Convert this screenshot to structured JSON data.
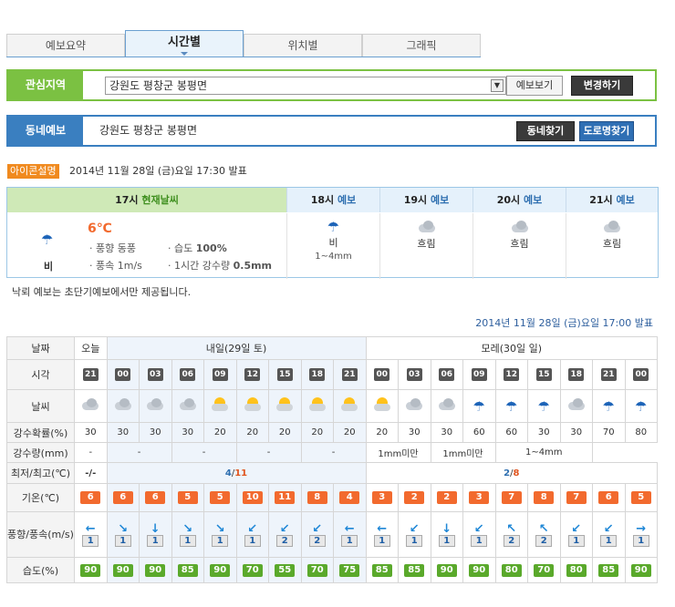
{
  "tabs": [
    "예보요약",
    "시간별",
    "위치별",
    "그래픽"
  ],
  "panel1": {
    "label": "관심지역",
    "select": "강원도 평창군 봉평면",
    "btn1": "예보보기",
    "btn2": "변경하기"
  },
  "panel2": {
    "label": "동네예보",
    "location": "강원도 평창군 봉평면",
    "btn1": "동네찾기",
    "btn2": "도로명찾기"
  },
  "icon_legend": "아이콘설명",
  "issue_time_1": "2014년 11월 28일 (금)요일 17:30 발표",
  "now": {
    "head_hour": "17시",
    "head_tag": "현재날씨",
    "weather": "비",
    "temp": "6℃",
    "wind_dir_label": "풍향",
    "wind_dir": "동풍",
    "humidity_label": "습도",
    "humidity": "100%",
    "wind_speed_label": "풍속",
    "wind_speed": "1m/s",
    "rain_label": "1시간 강수량",
    "rain": "0.5mm"
  },
  "short_forecast": [
    {
      "hour": "18시",
      "tag": "예보",
      "weather": "비",
      "amount": "1~4mm",
      "icon": "rain-icon"
    },
    {
      "hour": "19시",
      "tag": "예보",
      "weather": "흐림",
      "amount": "",
      "icon": "cloud-icon"
    },
    {
      "hour": "20시",
      "tag": "예보",
      "weather": "흐림",
      "amount": "",
      "icon": "cloud-icon"
    },
    {
      "hour": "21시",
      "tag": "예보",
      "weather": "흐림",
      "amount": "",
      "icon": "cloud-icon"
    }
  ],
  "notice": "낙뢰 예보는 초단기예보에서만 제공됩니다.",
  "issue_time_2": "2014년 11월 28일 (금)요일 17:00 발표",
  "table": {
    "labels": {
      "day": "날짜",
      "time": "시각",
      "weather": "날씨",
      "pop": "강수확률(%)",
      "precip": "강수량(mm)",
      "minmax": "최저/최고(℃)",
      "temp": "기온(℃)",
      "wind": "풍향/풍속(m/s)",
      "humidity": "습도(%)"
    },
    "days": {
      "today": "오늘",
      "tomorrow": "내일(29일 토)",
      "dayafter": "모레(30일 일)"
    },
    "hours": [
      "21",
      "00",
      "03",
      "06",
      "09",
      "12",
      "15",
      "18",
      "21",
      "00",
      "03",
      "06",
      "09",
      "12",
      "15",
      "18",
      "21",
      "00"
    ],
    "icons": [
      "cloud",
      "cloud",
      "cloud",
      "cloud",
      "sun",
      "sun",
      "sun",
      "cloud-sun",
      "cloud-sun",
      "cloud-sun",
      "cloud",
      "cloud",
      "rain",
      "rain",
      "rain",
      "cloud",
      "rain",
      "rain"
    ],
    "pop": [
      "30",
      "30",
      "30",
      "30",
      "20",
      "20",
      "20",
      "20",
      "20",
      "20",
      "30",
      "30",
      "60",
      "60",
      "30",
      "30",
      "70",
      "80"
    ],
    "precip": [
      "-",
      "-",
      "-",
      "-",
      "-",
      "1mm미만",
      "1mm미만",
      "1~4mm"
    ],
    "minmax": {
      "today": "-/-",
      "tomorrow_min": "4",
      "tomorrow_max": "11",
      "dayafter_min": "2",
      "dayafter_max": "8"
    },
    "temps": [
      "6",
      "6",
      "6",
      "5",
      "5",
      "10",
      "11",
      "8",
      "4",
      "3",
      "2",
      "2",
      "3",
      "7",
      "8",
      "7",
      "6",
      "5"
    ],
    "wind_dirs": [
      "←",
      "↘",
      "↓",
      "↘",
      "↘",
      "↙",
      "↙",
      "↙",
      "←",
      "←",
      "↙",
      "↓",
      "↙",
      "↖",
      "↖",
      "↙",
      "↙",
      "→"
    ],
    "wind_speeds": [
      "1",
      "1",
      "1",
      "1",
      "1",
      "1",
      "2",
      "2",
      "1",
      "1",
      "1",
      "1",
      "1",
      "2",
      "2",
      "1",
      "1",
      "1"
    ],
    "humidity": [
      "90",
      "90",
      "90",
      "85",
      "90",
      "70",
      "55",
      "70",
      "75",
      "85",
      "85",
      "90",
      "90",
      "80",
      "70",
      "80",
      "85",
      "90"
    ]
  }
}
